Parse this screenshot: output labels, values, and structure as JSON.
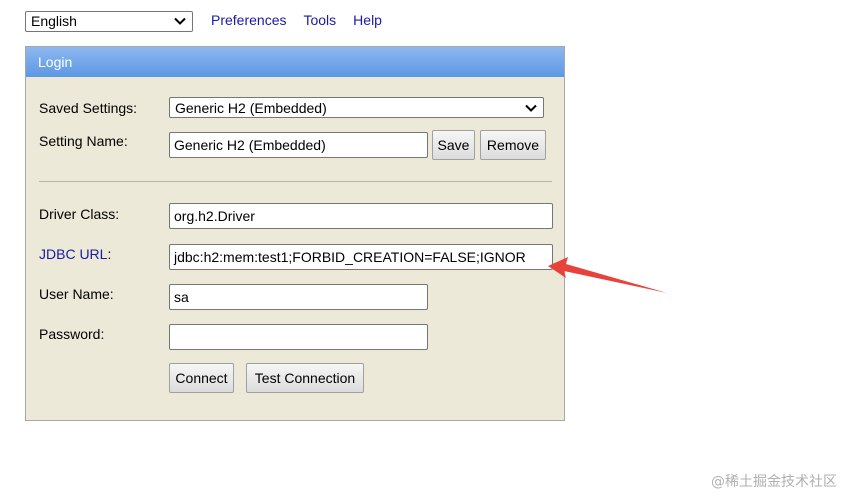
{
  "language": {
    "selected": "English"
  },
  "nav": {
    "links": [
      "Preferences",
      "Tools",
      "Help"
    ]
  },
  "login": {
    "title": "Login",
    "saved_settings_label": "Saved Settings:",
    "saved_settings_value": "Generic H2 (Embedded)",
    "setting_name_label": "Setting Name:",
    "setting_name_value": "Generic H2 (Embedded)",
    "save_label": "Save",
    "remove_label": "Remove",
    "driver_class_label": "Driver Class:",
    "driver_class_value": "org.h2.Driver",
    "jdbc_url_label": "JDBC URL",
    "jdbc_url_colon": ":",
    "jdbc_url_value": "jdbc:h2:mem:test1;FORBID_CREATION=FALSE;IGNOR",
    "user_name_label": "User Name:",
    "user_name_value": "sa",
    "password_label": "Password:",
    "password_value": "",
    "connect_label": "Connect",
    "test_connection_label": "Test Connection"
  },
  "annotation": {
    "arrow_color": "#e8433b"
  },
  "watermark": "@稀土掘金技术社区"
}
